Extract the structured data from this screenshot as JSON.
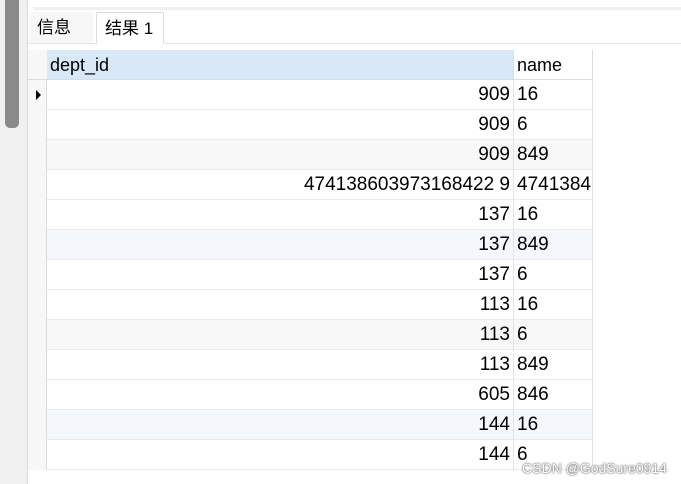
{
  "tabs": [
    {
      "label": "信息",
      "active": false
    },
    {
      "label": "结果 1",
      "active": true
    }
  ],
  "grid": {
    "columns": [
      "dept_id",
      "name"
    ],
    "rows": [
      [
        "909",
        "16"
      ],
      [
        "909",
        "6"
      ],
      [
        "909",
        "849"
      ],
      [
        "474138603973168422 9",
        "4741384"
      ],
      [
        "137",
        "16"
      ],
      [
        "137",
        "849"
      ],
      [
        "137",
        "6"
      ],
      [
        "113",
        "16"
      ],
      [
        "113",
        "6"
      ],
      [
        "113",
        "849"
      ],
      [
        "605",
        "846"
      ],
      [
        "144",
        "16"
      ],
      [
        "144",
        "6"
      ]
    ],
    "current_row": 0
  },
  "watermark": "CSDN @GodSure0914",
  "colors": {
    "header_selected": "#d9e8f7",
    "row_alt": "#f8f8f8",
    "row_highlight": "#f4f8fd"
  }
}
